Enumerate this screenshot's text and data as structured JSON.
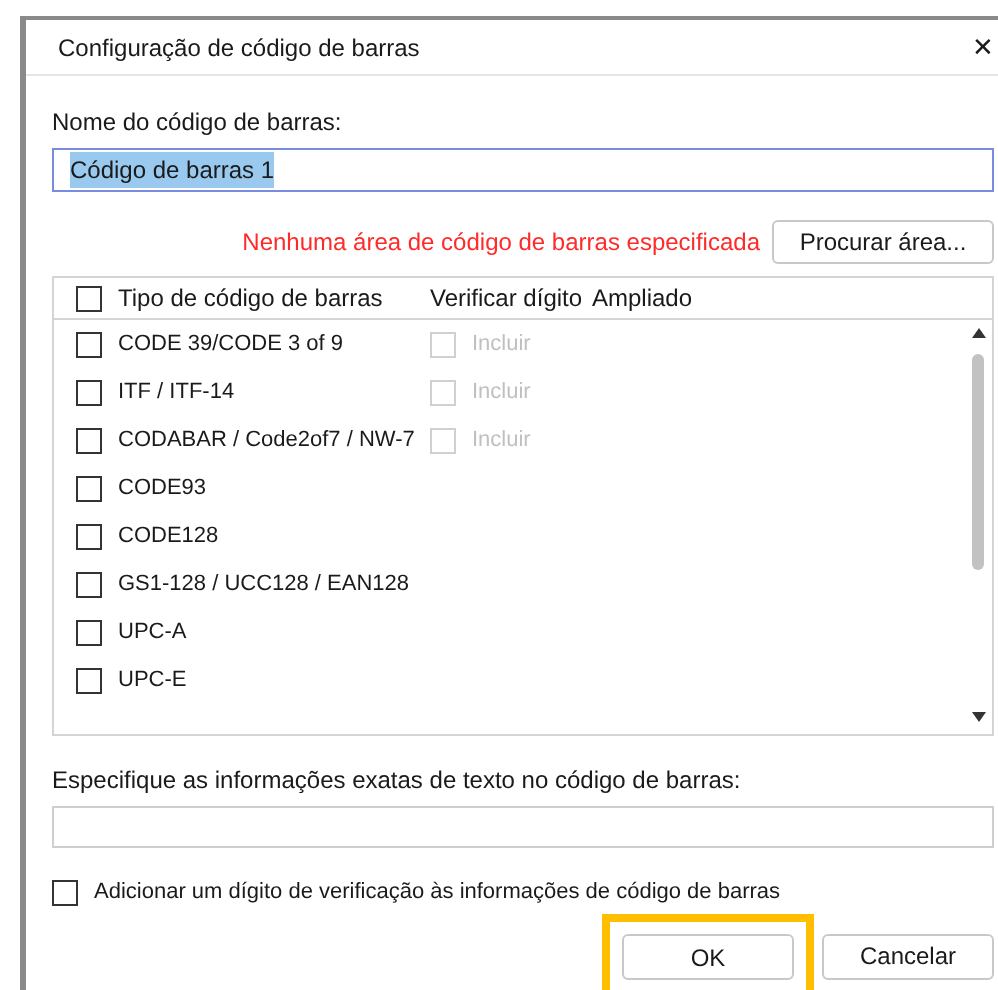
{
  "window": {
    "title": "Configuração de código de barras",
    "close": "✕"
  },
  "name_field": {
    "label": "Nome do código de barras:",
    "value": "Código de barras 1",
    "selected": true
  },
  "warning": "Nenhuma área de código de barras especificada",
  "browse_button": "Procurar área...",
  "barcode_list": {
    "columns": [
      "Tipo de código de barras",
      "Verificar dígito",
      "Ampliado"
    ],
    "header_checked": false,
    "rows": [
      {
        "name": "CODE 39/CODE 3 of 9",
        "checked": false,
        "check_digit": {
          "label": "Incluir",
          "checked": false,
          "disabled": true
        }
      },
      {
        "name": "ITF / ITF-14",
        "checked": false,
        "check_digit": {
          "label": "Incluir",
          "checked": false,
          "disabled": true
        }
      },
      {
        "name": "CODABAR / Code2of7 / NW-7",
        "checked": false,
        "check_digit": {
          "label": "Incluir",
          "checked": false,
          "disabled": true
        }
      },
      {
        "name": "CODE93",
        "checked": false
      },
      {
        "name": "CODE128",
        "checked": false
      },
      {
        "name": "GS1-128 / UCC128 / EAN128",
        "checked": false
      },
      {
        "name": "UPC-A",
        "checked": false
      },
      {
        "name": "UPC-E",
        "checked": false
      }
    ]
  },
  "text_field": {
    "label": "Especifique as informações exatas de texto no código de barras:"
  },
  "add_check_digit": {
    "label": "Adicionar um dígito de verificação às informações de código de barras",
    "checked": false
  },
  "buttons": [
    {
      "label": "OK",
      "highlighted": true
    },
    {
      "label": "Cancelar",
      "highlighted": false
    }
  ]
}
